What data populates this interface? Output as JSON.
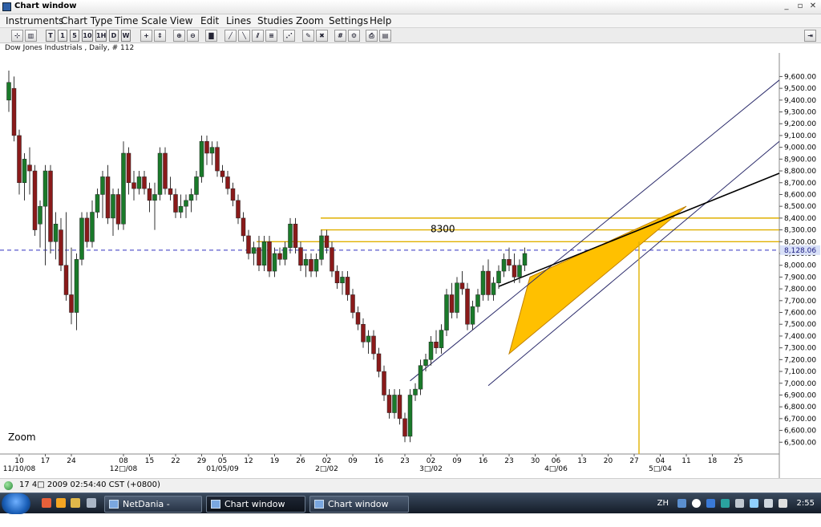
{
  "window": {
    "title": "Chart window",
    "min_label": "_",
    "restore_label": "▫",
    "close_label": "✕"
  },
  "menu": [
    "Instruments",
    "Chart Type",
    "Time Scale",
    "View",
    "Edit",
    "Lines",
    "Studies",
    "Zoom",
    "Settings",
    "Help"
  ],
  "toolbar": {
    "timeframes": [
      "T",
      "1",
      "5",
      "10",
      "1H",
      "D",
      "W"
    ]
  },
  "caption": "Dow Jones Industrials , Daily, # 112",
  "status": "17 4□ 2009 02:54:40  CST (+0800)",
  "chart_data": {
    "type": "candlestick",
    "instrument": "Dow Jones Industrials , Daily, # 112",
    "ylim": [
      6400,
      9800
    ],
    "yticks": [
      6500,
      6600,
      6700,
      6800,
      6900,
      7000,
      7100,
      7200,
      7300,
      7400,
      7500,
      7600,
      7700,
      7800,
      7900,
      8000,
      8100,
      8200,
      8300,
      8400,
      8500,
      8600,
      8700,
      8800,
      8900,
      9000,
      9100,
      9200,
      9300,
      9400,
      9500,
      9600
    ],
    "current_price": 8128.06,
    "current_price_label": "8,128.06",
    "annotation_label": "8300",
    "zoom_label": "Zoom",
    "up_color": "#1a7a2a",
    "down_color": "#8a1a1a",
    "channel_fill": "#ffc000",
    "xticks": [
      {
        "i": 2,
        "day": "10",
        "month": "11/10/08"
      },
      {
        "i": 7,
        "day": "17",
        "month": ""
      },
      {
        "i": 12,
        "day": "24",
        "month": ""
      },
      {
        "i": 22,
        "day": "08",
        "month": "12□/08"
      },
      {
        "i": 27,
        "day": "15",
        "month": ""
      },
      {
        "i": 32,
        "day": "22",
        "month": ""
      },
      {
        "i": 37,
        "day": "29",
        "month": ""
      },
      {
        "i": 41,
        "day": "05",
        "month": "01/05/09"
      },
      {
        "i": 46,
        "day": "12",
        "month": ""
      },
      {
        "i": 51,
        "day": "19",
        "month": ""
      },
      {
        "i": 56,
        "day": "26",
        "month": ""
      },
      {
        "i": 61,
        "day": "02",
        "month": "2□/02"
      },
      {
        "i": 66,
        "day": "09",
        "month": ""
      },
      {
        "i": 71,
        "day": "16",
        "month": ""
      },
      {
        "i": 76,
        "day": "23",
        "month": ""
      },
      {
        "i": 81,
        "day": "02",
        "month": "3□/02"
      },
      {
        "i": 86,
        "day": "09",
        "month": ""
      },
      {
        "i": 91,
        "day": "16",
        "month": ""
      },
      {
        "i": 96,
        "day": "23",
        "month": ""
      },
      {
        "i": 101,
        "day": "30",
        "month": ""
      },
      {
        "i": 105,
        "day": "06",
        "month": "4□/06"
      },
      {
        "i": 110,
        "day": "13",
        "month": ""
      },
      {
        "i": 115,
        "day": "20",
        "month": ""
      },
      {
        "i": 120,
        "day": "27",
        "month": ""
      },
      {
        "i": 125,
        "day": "04",
        "month": "5□/04"
      },
      {
        "i": 130,
        "day": "11",
        "month": ""
      },
      {
        "i": 135,
        "day": "18",
        "month": ""
      },
      {
        "i": 140,
        "day": "25",
        "month": ""
      }
    ],
    "candles": [
      [
        9400,
        9650,
        9300,
        9550
      ],
      [
        9500,
        9600,
        9050,
        9100
      ],
      [
        9100,
        9150,
        8600,
        8700
      ],
      [
        8700,
        8950,
        8550,
        8900
      ],
      [
        8850,
        9000,
        8600,
        8800
      ],
      [
        8800,
        8850,
        8250,
        8300
      ],
      [
        8350,
        8550,
        8150,
        8500
      ],
      [
        8500,
        8850,
        8000,
        8800
      ],
      [
        8800,
        8850,
        8100,
        8200
      ],
      [
        8200,
        8450,
        8050,
        8350
      ],
      [
        8300,
        8400,
        7950,
        8000
      ],
      [
        8000,
        8450,
        7700,
        7750
      ],
      [
        7750,
        8150,
        7500,
        7600
      ],
      [
        7600,
        8100,
        7450,
        8050
      ],
      [
        8050,
        8450,
        8000,
        8400
      ],
      [
        8400,
        8450,
        8150,
        8200
      ],
      [
        8200,
        8550,
        8150,
        8450
      ],
      [
        8450,
        8650,
        8400,
        8600
      ],
      [
        8600,
        8800,
        8400,
        8750
      ],
      [
        8750,
        8850,
        8350,
        8400
      ],
      [
        8400,
        8650,
        8250,
        8600
      ],
      [
        8600,
        8650,
        8300,
        8350
      ],
      [
        8350,
        9050,
        8300,
        8950
      ],
      [
        8950,
        9000,
        8600,
        8700
      ],
      [
        8700,
        8800,
        8550,
        8650
      ],
      [
        8650,
        8800,
        8600,
        8750
      ],
      [
        8750,
        8800,
        8600,
        8650
      ],
      [
        8650,
        8700,
        8450,
        8550
      ],
      [
        8550,
        8700,
        8300,
        8600
      ],
      [
        8600,
        9000,
        8550,
        8950
      ],
      [
        8950,
        9000,
        8600,
        8650
      ],
      [
        8650,
        8750,
        8550,
        8600
      ],
      [
        8600,
        8650,
        8400,
        8450
      ],
      [
        8450,
        8600,
        8400,
        8500
      ],
      [
        8500,
        8600,
        8400,
        8550
      ],
      [
        8550,
        8650,
        8450,
        8600
      ],
      [
        8600,
        8800,
        8550,
        8750
      ],
      [
        8750,
        9100,
        8700,
        9050
      ],
      [
        9050,
        9100,
        8850,
        8950
      ],
      [
        8950,
        9050,
        8850,
        9000
      ],
      [
        9000,
        9050,
        8750,
        8800
      ],
      [
        8800,
        8850,
        8700,
        8750
      ],
      [
        8750,
        8800,
        8600,
        8650
      ],
      [
        8650,
        8700,
        8500,
        8550
      ],
      [
        8550,
        8600,
        8350,
        8400
      ],
      [
        8400,
        8450,
        8200,
        8250
      ],
      [
        8250,
        8300,
        8050,
        8100
      ],
      [
        8100,
        8200,
        8000,
        8150
      ],
      [
        8150,
        8250,
        7950,
        8000
      ],
      [
        8000,
        8250,
        7950,
        8200
      ],
      [
        8200,
        8250,
        7900,
        7950
      ],
      [
        7950,
        8150,
        7900,
        8100
      ],
      [
        8100,
        8150,
        8000,
        8050
      ],
      [
        8050,
        8200,
        8000,
        8150
      ],
      [
        8150,
        8400,
        8100,
        8350
      ],
      [
        8350,
        8400,
        8100,
        8150
      ],
      [
        8150,
        8200,
        7950,
        8000
      ],
      [
        8000,
        8100,
        7900,
        8050
      ],
      [
        8050,
        8100,
        7900,
        7950
      ],
      [
        7950,
        8100,
        7900,
        8050
      ],
      [
        8050,
        8300,
        8000,
        8250
      ],
      [
        8250,
        8300,
        8100,
        8150
      ],
      [
        8150,
        8200,
        7900,
        7950
      ],
      [
        7950,
        8000,
        7800,
        7850
      ],
      [
        7850,
        7950,
        7750,
        7900
      ],
      [
        7900,
        7950,
        7700,
        7750
      ],
      [
        7750,
        7800,
        7550,
        7600
      ],
      [
        7600,
        7650,
        7450,
        7500
      ],
      [
        7500,
        7550,
        7300,
        7350
      ],
      [
        7350,
        7450,
        7250,
        7400
      ],
      [
        7400,
        7450,
        7200,
        7250
      ],
      [
        7250,
        7300,
        7050,
        7100
      ],
      [
        7100,
        7150,
        6850,
        6900
      ],
      [
        6900,
        6950,
        6700,
        6750
      ],
      [
        6750,
        6950,
        6700,
        6900
      ],
      [
        6900,
        6950,
        6650,
        6700
      ],
      [
        6700,
        6750,
        6500,
        6550
      ],
      [
        6550,
        6950,
        6500,
        6900
      ],
      [
        6900,
        7000,
        6850,
        6950
      ],
      [
        6950,
        7200,
        6900,
        7150
      ],
      [
        7150,
        7250,
        7100,
        7200
      ],
      [
        7200,
        7400,
        7150,
        7350
      ],
      [
        7350,
        7450,
        7250,
        7300
      ],
      [
        7300,
        7500,
        7250,
        7450
      ],
      [
        7450,
        7800,
        7400,
        7750
      ],
      [
        7750,
        7850,
        7550,
        7600
      ],
      [
        7600,
        7900,
        7550,
        7850
      ],
      [
        7850,
        7950,
        7750,
        7800
      ],
      [
        7800,
        7850,
        7450,
        7500
      ],
      [
        7500,
        7700,
        7450,
        7650
      ],
      [
        7650,
        7800,
        7600,
        7750
      ],
      [
        7750,
        8000,
        7700,
        7950
      ],
      [
        7950,
        8050,
        7700,
        7750
      ],
      [
        7750,
        7900,
        7700,
        7850
      ],
      [
        7850,
        8000,
        7800,
        7950
      ],
      [
        7950,
        8100,
        7900,
        8050
      ],
      [
        8050,
        8150,
        7950,
        8000
      ],
      [
        8000,
        8100,
        7850,
        7900
      ],
      [
        7900,
        8050,
        7850,
        8000
      ],
      [
        8000,
        8150,
        7950,
        8100
      ]
    ]
  }
}
